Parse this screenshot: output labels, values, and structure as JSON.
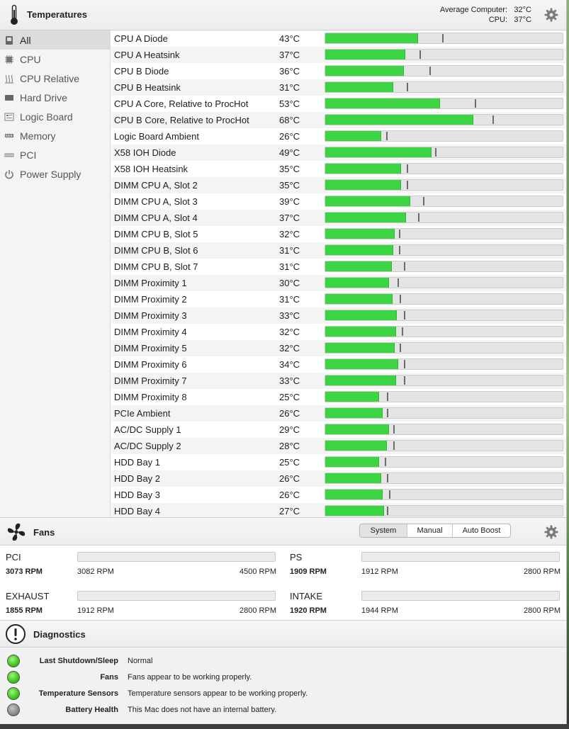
{
  "header": {
    "title": "Temperatures",
    "avg_label": "Average Computer:",
    "avg_value": "32°C",
    "cpu_label": "CPU:",
    "cpu_value": "37°C"
  },
  "sidebar": {
    "items": [
      {
        "label": "All",
        "icon": "all-sensors-icon",
        "active": true
      },
      {
        "label": "CPU",
        "icon": "cpu-icon",
        "active": false
      },
      {
        "label": "CPU Relative",
        "icon": "cpu-relative-icon",
        "active": false
      },
      {
        "label": "Hard Drive",
        "icon": "hard-drive-icon",
        "active": false
      },
      {
        "label": "Logic Board",
        "icon": "logic-board-icon",
        "active": false
      },
      {
        "label": "Memory",
        "icon": "memory-icon",
        "active": false
      },
      {
        "label": "PCI",
        "icon": "pci-icon",
        "active": false
      },
      {
        "label": "Power Supply",
        "icon": "power-icon",
        "active": false
      }
    ]
  },
  "sensors": [
    {
      "name": "CPU A Diode",
      "temp": "43°C",
      "level": 0.39,
      "max_marker": 0.49
    },
    {
      "name": "CPU A Heatsink",
      "temp": "37°C",
      "level": 0.335,
      "max_marker": 0.395
    },
    {
      "name": "CPU B Diode",
      "temp": "36°C",
      "level": 0.33,
      "max_marker": 0.435
    },
    {
      "name": "CPU B Heatsink",
      "temp": "31°C",
      "level": 0.285,
      "max_marker": 0.34
    },
    {
      "name": "CPU A Core, Relative to ProcHot",
      "temp": "53°C",
      "level": 0.48,
      "max_marker": 0.625
    },
    {
      "name": "CPU B Core, Relative to ProcHot",
      "temp": "68°C",
      "level": 0.62,
      "max_marker": 0.7
    },
    {
      "name": "Logic Board Ambient",
      "temp": "26°C",
      "level": 0.235,
      "max_marker": 0.255
    },
    {
      "name": "X58 IOH Diode",
      "temp": "49°C",
      "level": 0.445,
      "max_marker": 0.46
    },
    {
      "name": "X58 IOH Heatsink",
      "temp": "35°C",
      "level": 0.318,
      "max_marker": 0.34
    },
    {
      "name": "DIMM CPU A, Slot 2",
      "temp": "35°C",
      "level": 0.318,
      "max_marker": 0.34
    },
    {
      "name": "DIMM CPU A, Slot 3",
      "temp": "39°C",
      "level": 0.355,
      "max_marker": 0.41
    },
    {
      "name": "DIMM CPU A, Slot 4",
      "temp": "37°C",
      "level": 0.338,
      "max_marker": 0.39
    },
    {
      "name": "DIMM CPU B, Slot 5",
      "temp": "32°C",
      "level": 0.292,
      "max_marker": 0.31
    },
    {
      "name": "DIMM CPU B, Slot 6",
      "temp": "31°C",
      "level": 0.285,
      "max_marker": 0.31
    },
    {
      "name": "DIMM CPU B, Slot 7",
      "temp": "31°C",
      "level": 0.28,
      "max_marker": 0.328
    },
    {
      "name": "DIMM Proximity 1",
      "temp": "30°C",
      "level": 0.268,
      "max_marker": 0.302
    },
    {
      "name": "DIMM Proximity 2",
      "temp": "31°C",
      "level": 0.282,
      "max_marker": 0.312
    },
    {
      "name": "DIMM Proximity 3",
      "temp": "33°C",
      "level": 0.3,
      "max_marker": 0.328
    },
    {
      "name": "DIMM Proximity 4",
      "temp": "32°C",
      "level": 0.296,
      "max_marker": 0.32
    },
    {
      "name": "DIMM Proximity 5",
      "temp": "32°C",
      "level": 0.29,
      "max_marker": 0.312
    },
    {
      "name": "DIMM Proximity 6",
      "temp": "34°C",
      "level": 0.305,
      "max_marker": 0.328
    },
    {
      "name": "DIMM Proximity 7",
      "temp": "33°C",
      "level": 0.298,
      "max_marker": 0.328
    },
    {
      "name": "DIMM Proximity 8",
      "temp": "25°C",
      "level": 0.227,
      "max_marker": 0.258
    },
    {
      "name": "PCIe Ambient",
      "temp": "26°C",
      "level": 0.24,
      "max_marker": 0.258
    },
    {
      "name": "AC/DC Supply 1",
      "temp": "29°C",
      "level": 0.268,
      "max_marker": 0.285
    },
    {
      "name": "AC/DC Supply 2",
      "temp": "28°C",
      "level": 0.258,
      "max_marker": 0.285
    },
    {
      "name": "HDD Bay 1",
      "temp": "25°C",
      "level": 0.227,
      "max_marker": 0.248
    },
    {
      "name": "HDD Bay 2",
      "temp": "26°C",
      "level": 0.235,
      "max_marker": 0.258
    },
    {
      "name": "HDD Bay 3",
      "temp": "26°C",
      "level": 0.24,
      "max_marker": 0.268
    },
    {
      "name": "HDD Bay 4",
      "temp": "27°C",
      "level": 0.245,
      "max_marker": 0.258
    }
  ],
  "fans": {
    "title": "Fans",
    "modes": [
      "System",
      "Manual",
      "Auto Boost"
    ],
    "selected_mode": "System",
    "items": [
      {
        "name": "PCI",
        "current": "3073 RPM",
        "min": "3082 RPM",
        "max": "4500 RPM"
      },
      {
        "name": "PS",
        "current": "1909 RPM",
        "min": "1912 RPM",
        "max": "2800 RPM"
      },
      {
        "name": "EXHAUST",
        "current": "1855 RPM",
        "min": "1912 RPM",
        "max": "2800 RPM"
      },
      {
        "name": "INTAKE",
        "current": "1920 RPM",
        "min": "1944 RPM",
        "max": "2800 RPM"
      }
    ]
  },
  "diagnostics": {
    "title": "Diagnostics",
    "rows": [
      {
        "label": "Last Shutdown/Sleep",
        "value": "Normal",
        "status": "green"
      },
      {
        "label": "Fans",
        "value": "Fans appear to be working properly.",
        "status": "green"
      },
      {
        "label": "Temperature Sensors",
        "value": "Temperature sensors appear to be working properly.",
        "status": "green"
      },
      {
        "label": "Battery Health",
        "value": "This Mac does not have an internal battery.",
        "status": "gray"
      }
    ]
  },
  "colors": {
    "bar_fill": "#3dd444",
    "status_green": "#3fc71c",
    "status_gray": "#8a8a8a"
  }
}
